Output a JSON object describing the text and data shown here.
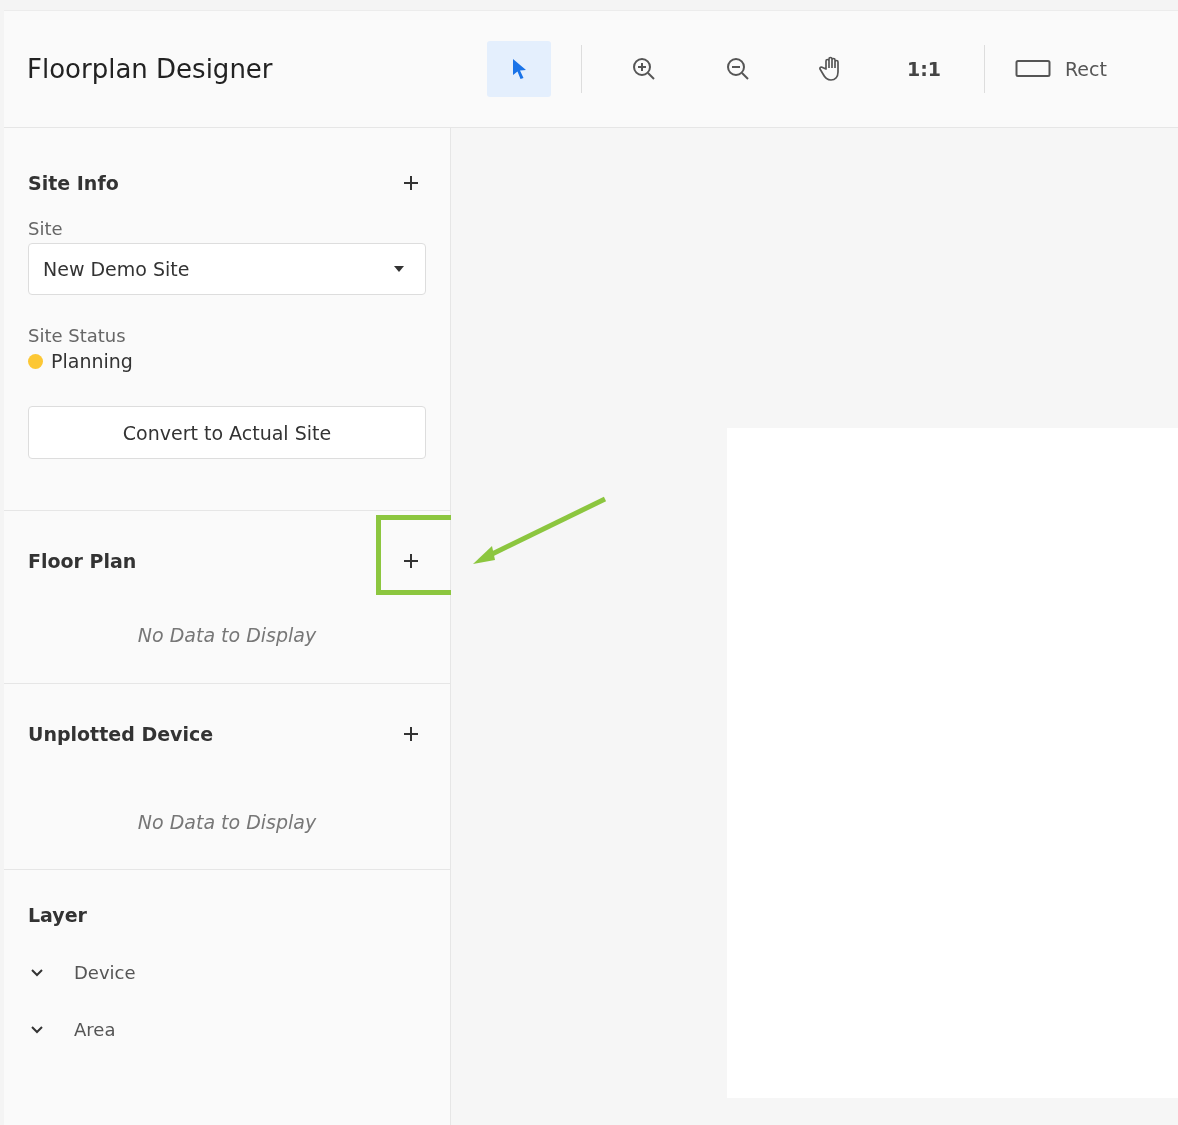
{
  "header": {
    "title": "Floorplan Designer"
  },
  "toolbar": {
    "groups": [
      [
        {
          "kind": "select",
          "selected": true
        }
      ],
      [
        {
          "kind": "zoom-in",
          "selected": false
        },
        {
          "kind": "zoom-out",
          "selected": false
        },
        {
          "kind": "pan",
          "selected": false
        },
        {
          "kind": "ratio",
          "selected": false,
          "label": "1:1"
        }
      ],
      [
        {
          "kind": "rect",
          "selected": false,
          "label": "Rect"
        }
      ]
    ]
  },
  "site_info": {
    "title": "Site Info",
    "site_label": "Site",
    "site_value": "New Demo Site",
    "status_label": "Site Status",
    "status": {
      "text": "Planning",
      "color": "#fcc734"
    },
    "convert_button": "Convert to Actual Site"
  },
  "floor_plan": {
    "title": "Floor Plan",
    "empty": "No Data to Display",
    "highlighted": true
  },
  "unplotted_device": {
    "title": "Unplotted Device",
    "empty": "No Data to Display"
  },
  "layer": {
    "title": "Layer",
    "items": [
      {
        "label": "Device",
        "expanded": true
      },
      {
        "label": "Area",
        "expanded": true
      }
    ]
  }
}
